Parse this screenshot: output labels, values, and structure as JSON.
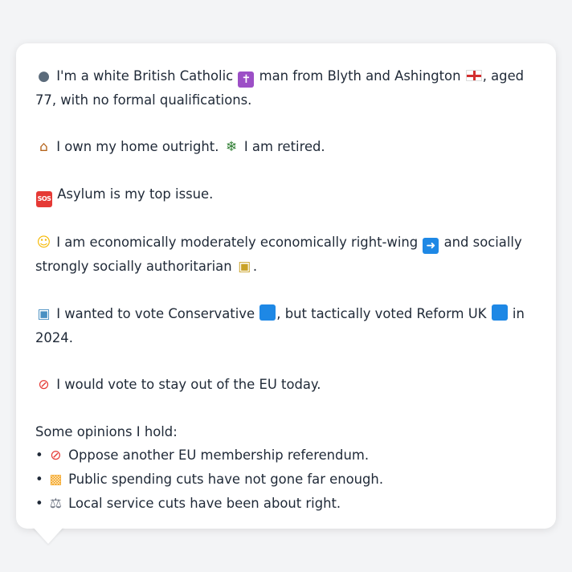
{
  "card": {
    "line_identity_a": "I'm a white British Catholic",
    "line_identity_b": "man from Blyth and Ashington",
    "line_identity_c": ", aged 77, with no formal qualifications.",
    "line_home_a": "I own my home outright.",
    "line_home_b": "I am retired.",
    "line_issue": "Asylum is my top issue.",
    "line_ideology_a": "I am economically moderately economically right-wing",
    "line_ideology_b": "and socially strongly socially authoritarian",
    "line_ideology_c": ".",
    "line_vote_a": "I wanted to vote Conservative",
    "line_vote_b": ", but tactically voted Reform UK",
    "line_vote_c": "in 2024.",
    "line_eu": "I would vote to stay out of the EU today.",
    "opinions_heading": "Some opinions I hold:",
    "opinions": [
      "Oppose another EU membership referendum.",
      "Public spending cuts have not gone far enough.",
      "Local service cuts have been about right."
    ]
  },
  "icons": {
    "person": "person-silhouette-icon",
    "cross": "latin-cross-icon",
    "flag": "england-flag-icon",
    "house": "house-icon",
    "palm": "palm-tree-icon",
    "sos": "sos-icon",
    "thinking": "thinking-face-icon",
    "arrow": "right-arrow-icon",
    "lock": "lock-icon",
    "ballot": "ballot-box-icon",
    "blue_square": "blue-square-icon",
    "no_entry": "prohibited-icon",
    "construction": "construction-barrier-icon",
    "scales": "balance-scale-icon"
  },
  "colors": {
    "background": "#f3f4f6",
    "card": "#ffffff",
    "text": "#1f2937",
    "party_blue": "#1e88e5"
  }
}
